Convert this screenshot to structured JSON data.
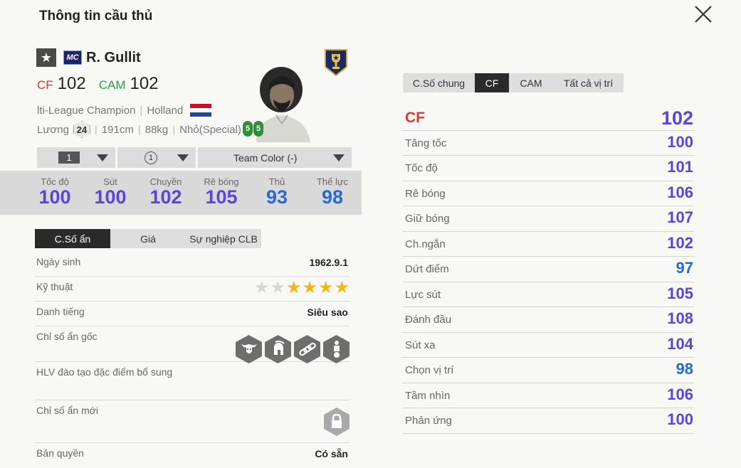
{
  "page": {
    "title": "Thông tin cầu thủ"
  },
  "player": {
    "season_code": "MC",
    "name": "R. Gullit",
    "positions": [
      {
        "pos": "CF",
        "ovr": "102",
        "color": "#d63a3a"
      },
      {
        "pos": "CAM",
        "ovr": "102",
        "color": "#27a047"
      }
    ],
    "league": "lti-League Champion",
    "nation": "Holland",
    "salary_label": "Lương",
    "salary": "24",
    "height": "191cm",
    "weight": "88kg",
    "body_type": "Nhỏ(Special)",
    "foot_left": "5",
    "foot_right": "5"
  },
  "selectors": {
    "level": "1",
    "upgrade": "1",
    "team_color": "Team Color (-)"
  },
  "main_stats": [
    {
      "label": "Tốc độ",
      "value": "100",
      "color": "#5a45d6"
    },
    {
      "label": "Sút",
      "value": "100",
      "color": "#5a45d6"
    },
    {
      "label": "Chuyền",
      "value": "102",
      "color": "#5a45d6"
    },
    {
      "label": "Rê bóng",
      "value": "105",
      "color": "#5a45d6"
    },
    {
      "label": "Thủ",
      "value": "93",
      "color": "#2a67d6"
    },
    {
      "label": "Thể lực",
      "value": "98",
      "color": "#2a67d6"
    }
  ],
  "left_tabs": [
    "C.Số ẩn",
    "Giá",
    "Sự nghiệp CLB"
  ],
  "details": {
    "birth_label": "Ngày sinh",
    "birth_value": "1962.9.1",
    "skill_label": "Kỹ thuật",
    "skill_stars": 4,
    "skill_max": 6,
    "fame_label": "Danh tiếng",
    "fame_value": "Siêu sao",
    "hidden_label": "Chỉ số ẩn gốc",
    "hidden_icons": [
      "bull-icon",
      "spartan-helmet-icon",
      "chain-icon",
      "player-ball-icon"
    ],
    "coach_label": "HLV đào tạo đặc điểm bổ sung",
    "new_hidden_label": "Chỉ số ẩn mới",
    "copyright_label": "Bản quyền",
    "copyright_value": "Có sẵn"
  },
  "right_tabs": [
    "C.Số chung",
    "CF",
    "CAM",
    "Tất cả vị trí"
  ],
  "position_stats": {
    "header": {
      "label": "CF",
      "value": "102",
      "color": "#5a45d6"
    },
    "rows": [
      {
        "label": "Tăng tốc",
        "value": "100",
        "color": "#5a45d6"
      },
      {
        "label": "Tốc độ",
        "value": "101",
        "color": "#5a45d6"
      },
      {
        "label": "Rê bóng",
        "value": "106",
        "color": "#5a45d6"
      },
      {
        "label": "Giữ bóng",
        "value": "107",
        "color": "#5a45d6"
      },
      {
        "label": "Ch.ngắn",
        "value": "102",
        "color": "#5a45d6"
      },
      {
        "label": "Dứt điểm",
        "value": "97",
        "color": "#2a67d6"
      },
      {
        "label": "Lực sút",
        "value": "105",
        "color": "#5a45d6"
      },
      {
        "label": "Đánh đầu",
        "value": "108",
        "color": "#5a45d6"
      },
      {
        "label": "Sút xa",
        "value": "104",
        "color": "#5a45d6"
      },
      {
        "label": "Chọn vị trí",
        "value": "98",
        "color": "#2a67d6"
      },
      {
        "label": "Tầm nhìn",
        "value": "106",
        "color": "#5a45d6"
      },
      {
        "label": "Phản ứng",
        "value": "100",
        "color": "#5a45d6"
      }
    ]
  }
}
